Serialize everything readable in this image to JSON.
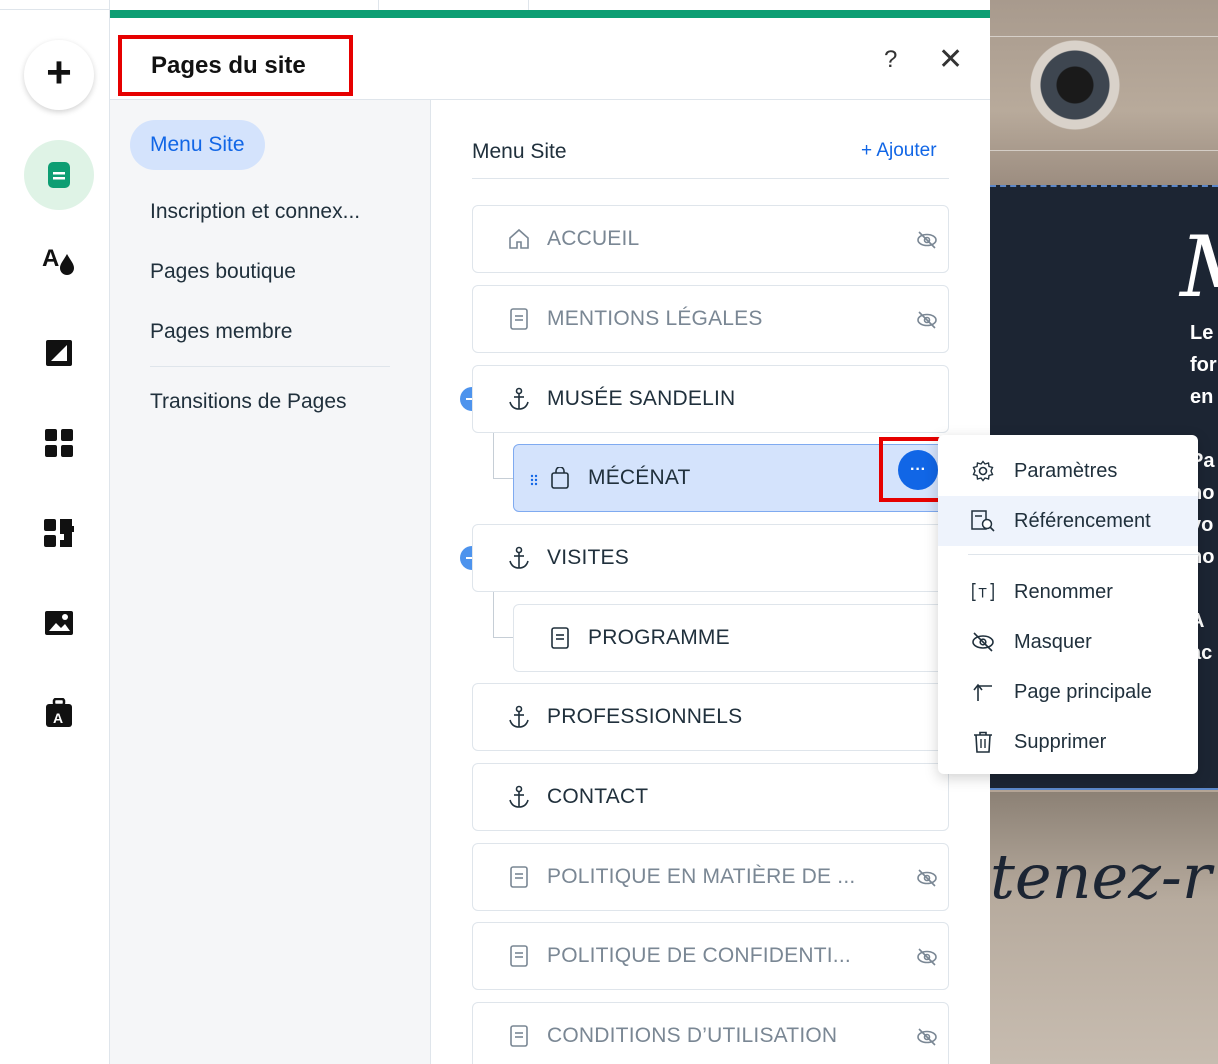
{
  "panel": {
    "title": "Pages du site",
    "help_label": "?",
    "close_label": "✕"
  },
  "left_nav": {
    "items": [
      {
        "label": "Menu Site"
      },
      {
        "label": "Inscription et connex..."
      },
      {
        "label": "Pages boutique"
      },
      {
        "label": "Pages membre"
      },
      {
        "label": "Transitions de Pages"
      }
    ]
  },
  "list": {
    "title": "Menu Site",
    "add_label": "+ Ajouter",
    "pages": [
      {
        "label": "ACCUEIL",
        "icon": "home-icon",
        "hidden": true
      },
      {
        "label": "MENTIONS LÉGALES",
        "icon": "page-icon",
        "hidden": true
      },
      {
        "label": "MUSÉE SANDELIN",
        "icon": "anchor-icon",
        "hidden": false
      },
      {
        "label": "MÉCÉNAT",
        "icon": "bag-icon",
        "hidden": false,
        "selected": true
      },
      {
        "label": "VISITES",
        "icon": "anchor-icon",
        "hidden": false
      },
      {
        "label": "PROGRAMME",
        "icon": "page-icon",
        "hidden": false
      },
      {
        "label": "PROFESSIONNELS",
        "icon": "anchor-icon",
        "hidden": false
      },
      {
        "label": "CONTACT",
        "icon": "anchor-icon",
        "hidden": false
      },
      {
        "label": "POLITIQUE EN MATIÈRE DE ...",
        "icon": "page-icon",
        "hidden": true
      },
      {
        "label": "POLITIQUE DE CONFIDENTI...",
        "icon": "page-icon",
        "hidden": true
      },
      {
        "label": "CONDITIONS D’UTILISATION",
        "icon": "page-icon",
        "hidden": true
      }
    ],
    "more_label": "···"
  },
  "context_menu": {
    "items": [
      {
        "label": "Paramètres",
        "icon": "gear-icon"
      },
      {
        "label": "Référencement",
        "icon": "seo-icon"
      },
      {
        "label": "Renommer",
        "icon": "rename-icon"
      },
      {
        "label": "Masquer",
        "icon": "hide-icon"
      },
      {
        "label": "Page principale",
        "icon": "main-page-icon"
      },
      {
        "label": "Supprimer",
        "icon": "trash-icon"
      }
    ]
  },
  "canvas_preview": {
    "big_letter": "M",
    "lines": [
      "Le",
      "for",
      "en",
      "Pa",
      "no",
      "vo",
      "no",
      "A",
      "ac"
    ],
    "tenez": "tenez-r"
  },
  "colors": {
    "accent_green": "#0d9e73",
    "accent_blue": "#1166e6",
    "highlight_red": "#e60000",
    "selected_bg": "#d4e3fc"
  }
}
